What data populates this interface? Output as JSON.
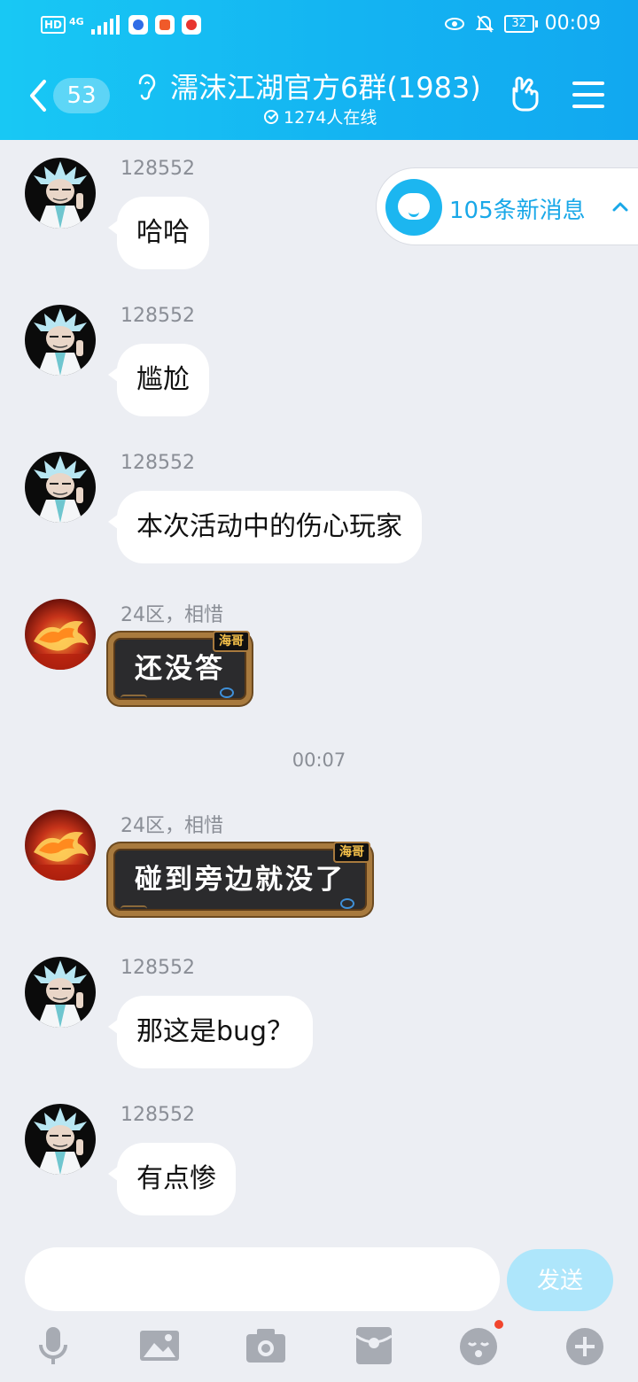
{
  "status_bar": {
    "network_badge": "HD",
    "network_type": "4G",
    "battery": "32",
    "time": "00:09"
  },
  "header": {
    "back_count": "53",
    "title": "濡沫江湖官方6群(1983)",
    "online": "1274人在线"
  },
  "new_messages": {
    "label": "105条新消息"
  },
  "messages": [
    {
      "sender": "128552",
      "text": "哈哈",
      "avatar": "rick-avatar"
    },
    {
      "sender": "128552",
      "text": "尴尬",
      "avatar": "rick-avatar"
    },
    {
      "sender": "128552",
      "text": "本次活动中的伤心玩家",
      "avatar": "rick-avatar"
    },
    {
      "sender": "24区，相惜",
      "text": "还没答",
      "sticker_tag": "海哥",
      "avatar": "fire-horse-avatar"
    },
    {
      "sender": "24区，相惜",
      "text": "碰到旁边就没了",
      "sticker_tag": "海哥",
      "avatar": "fire-horse-avatar"
    },
    {
      "sender": "128552",
      "text": "那这是bug？",
      "avatar": "rick-avatar"
    },
    {
      "sender": "128552",
      "text": "有点惨",
      "avatar": "rick-avatar"
    }
  ],
  "time_separator": "00:07",
  "composer": {
    "input_value": "",
    "send_label": "发送"
  },
  "toolbar_icons": [
    "microphone-icon",
    "image-icon",
    "camera-icon",
    "red-packet-icon",
    "emoji-icon",
    "plus-icon"
  ],
  "colors": {
    "header_gradient_start": "#18C8F4",
    "header_gradient_end": "#11A8F0",
    "background": "#ECEEF3",
    "accent": "#19A8E8",
    "send_disabled": "#AEE6FB",
    "toolbar_icon": "#A7ABB3",
    "notification_dot": "#F1452D"
  }
}
